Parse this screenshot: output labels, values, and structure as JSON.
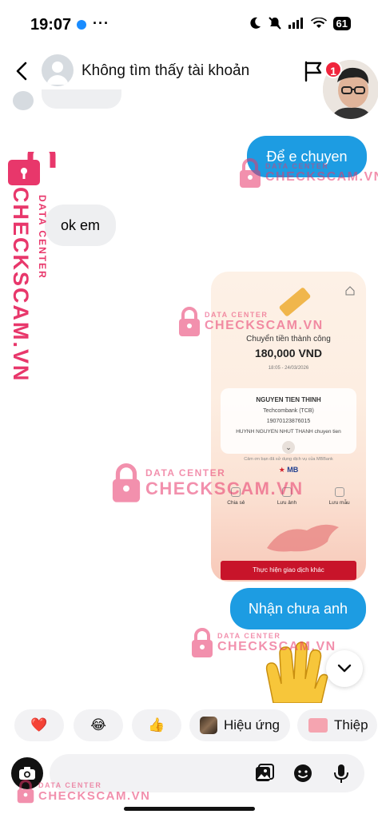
{
  "status_bar": {
    "time": "19:07",
    "more": "···",
    "battery": "61",
    "icons": [
      "messenger-icon",
      "moon-icon",
      "bell-slash-icon",
      "signal-icon",
      "wifi-icon",
      "battery-icon"
    ]
  },
  "header": {
    "title": "Không tìm thấy tài khoản",
    "badge_count": "1"
  },
  "messages": {
    "outgoing_1": "Để e chuyen",
    "incoming_1": "ok em",
    "outgoing_2": "Nhận chưa anh"
  },
  "receipt": {
    "title": "Chuyển tiền thành công",
    "amount": "180,000 VND",
    "time": "18:05 - 24/03/2026",
    "recipient": "NGUYEN TIEN THINH",
    "bank": "Techcombank (TCB)",
    "account": "19070123876015",
    "memo": "HUYNH NGUYEN NHUT THANH chuyen tien",
    "thanks": "Cảm ơn bạn đã sử dụng dịch vụ của MBBank",
    "brand": "MB",
    "actions": [
      "Chia sẻ",
      "Lưu ảnh",
      "Lưu mẫu"
    ],
    "cta": "Thực hiện giao dịch khác"
  },
  "quick_replies": {
    "heart": "❤️",
    "laugh": "😂",
    "like": "👍",
    "effects": "Hiệu ứng",
    "cards": "Thiệp"
  },
  "composer": {
    "placeholder": ""
  },
  "watermark": {
    "top": "DATA CENTER",
    "main": "CHECKSCAM.VN",
    "color": "#e8376b"
  },
  "colors": {
    "outgoing_bubble": "#1d9ce2",
    "incoming_bubble": "#eeeff1",
    "badge": "#f0243c"
  }
}
